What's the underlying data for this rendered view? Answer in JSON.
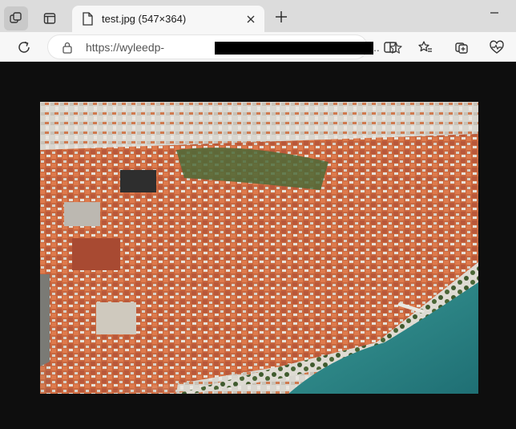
{
  "tab": {
    "title": "test.jpg (547×364)"
  },
  "address_bar": {
    "url_visible": "https://wyleedp-",
    "truncation": ".."
  },
  "image": {
    "alt": "test.jpg"
  },
  "icons": {
    "workspaces": "workspaces-icon",
    "tab_actions": "tab-actions-icon",
    "file": "file-icon",
    "close": "close-icon",
    "new_tab": "plus-icon",
    "minimize": "minimize-icon",
    "reload": "reload-icon",
    "lock": "lock-icon",
    "favorite": "star-icon",
    "split": "split-screen-icon",
    "favorites": "favorites-icon",
    "collections": "collections-icon",
    "performance": "heart-pulse-icon"
  }
}
